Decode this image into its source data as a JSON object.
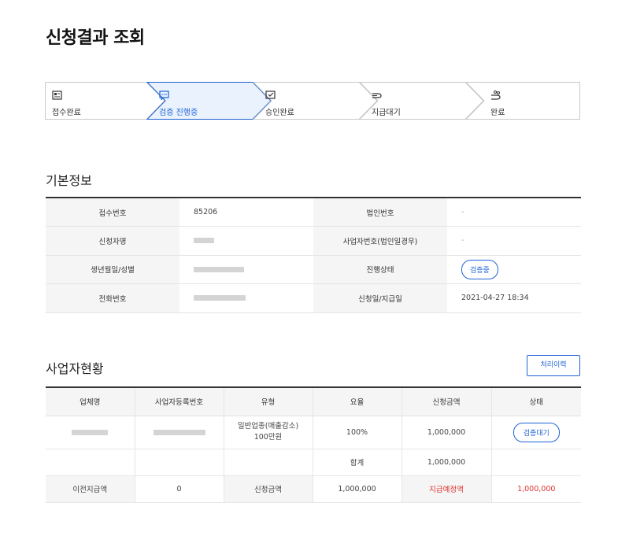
{
  "page": {
    "title": "신청결과 조회"
  },
  "stepper": {
    "steps": [
      {
        "label": "접수완료",
        "icon": "document-icon",
        "active": false
      },
      {
        "label": "검증 진행중",
        "icon": "chat-icon",
        "active": true
      },
      {
        "label": "승인완료",
        "icon": "check-mail-icon",
        "active": false
      },
      {
        "label": "지급대기",
        "icon": "hand-icon",
        "active": false
      },
      {
        "label": "완료",
        "icon": "coins-hand-icon",
        "active": false
      }
    ],
    "accent": "#1e63d6"
  },
  "basic_info": {
    "title": "기본정보",
    "rows": [
      {
        "l1": "접수번호",
        "v1": "85206",
        "l2": "법인번호",
        "v2": "-"
      },
      {
        "l1": "신청자명",
        "v1": "",
        "l2": "사업자번호(법인일경우)",
        "v2": "-"
      },
      {
        "l1": "생년월일/성별",
        "v1": "",
        "l2": "진행상태",
        "v2": "검증중"
      },
      {
        "l1": "전화번호",
        "v1": "",
        "l2": "신청일/지급일",
        "v2": "2021-04-27 18:34"
      }
    ]
  },
  "business": {
    "title": "사업자현황",
    "history_button": "처리이력",
    "headers": [
      "업체명",
      "사업자등록번호",
      "유형",
      "요율",
      "신청금액",
      "상태"
    ],
    "row": {
      "company": "",
      "reg_no": "",
      "type_line1": "일반업종(매출감소)",
      "type_line2": "100만원",
      "rate": "100%",
      "amount": "1,000,000",
      "status": "검증대기"
    },
    "total": {
      "label": "합계",
      "amount": "1,000,000"
    },
    "summary": {
      "prev_label": "이전지급액",
      "prev_value": "0",
      "req_label": "신청금액",
      "req_value": "1,000,000",
      "expected_label": "지급예정액",
      "expected_value": "1,000,000"
    }
  }
}
